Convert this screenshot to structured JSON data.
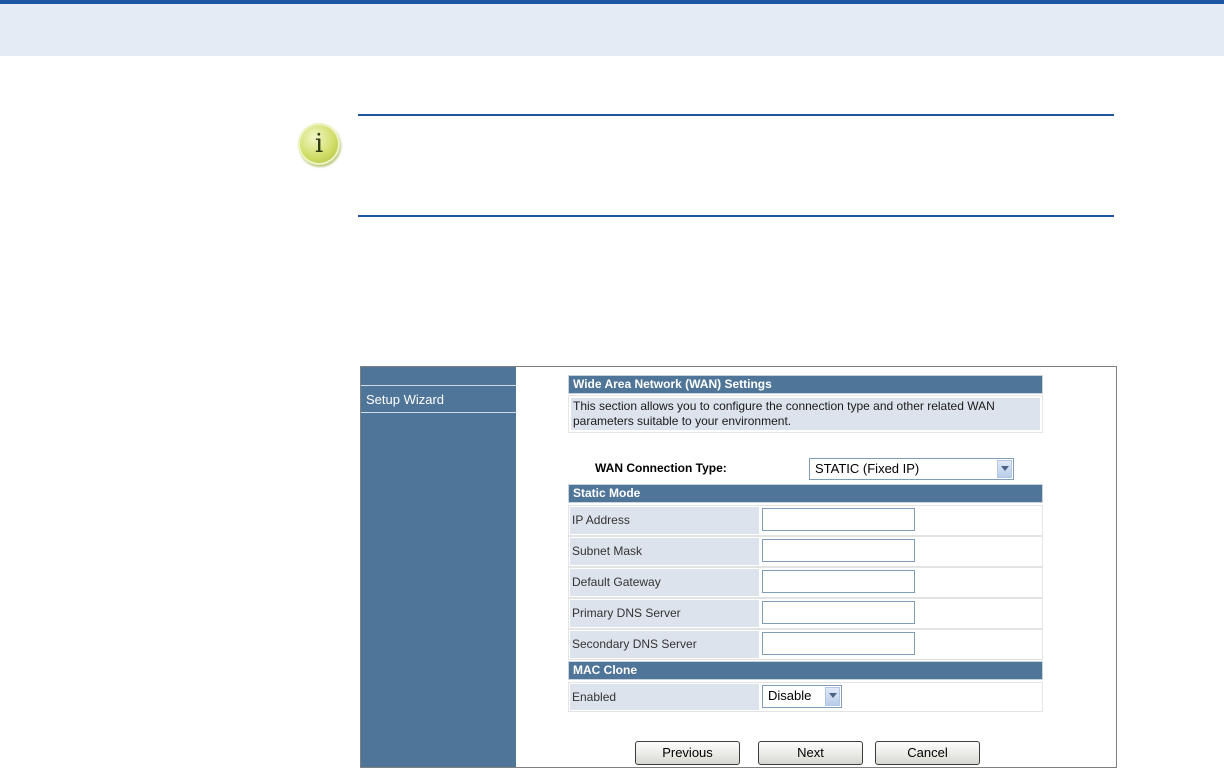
{
  "note": {
    "icon": "info-icon",
    "glyph": "i"
  },
  "sidebar": {
    "items": [
      {
        "label": "Setup Wizard"
      }
    ]
  },
  "wan": {
    "title": "Wide Area Network (WAN) Settings",
    "description": "This section allows you to configure the connection type and other related WAN parameters suitable to your environment.",
    "connection_type_label": "WAN Connection Type:",
    "connection_type_value": "STATIC (Fixed IP)"
  },
  "static_mode": {
    "title": "Static Mode",
    "fields": [
      {
        "label": "IP Address",
        "value": ""
      },
      {
        "label": "Subnet Mask",
        "value": ""
      },
      {
        "label": "Default Gateway",
        "value": ""
      },
      {
        "label": "Primary DNS Server",
        "value": ""
      },
      {
        "label": "Secondary DNS Server",
        "value": ""
      }
    ]
  },
  "mac_clone": {
    "title": "MAC Clone",
    "enabled_label": "Enabled",
    "enabled_value": "Disable"
  },
  "buttons": {
    "previous": "Previous",
    "next": "Next",
    "cancel": "Cancel"
  },
  "colors": {
    "accent": "#1e55a0",
    "sidebar": "#4f7599",
    "header_band": "#e4ebf5",
    "label_cell": "#dde3ec"
  }
}
